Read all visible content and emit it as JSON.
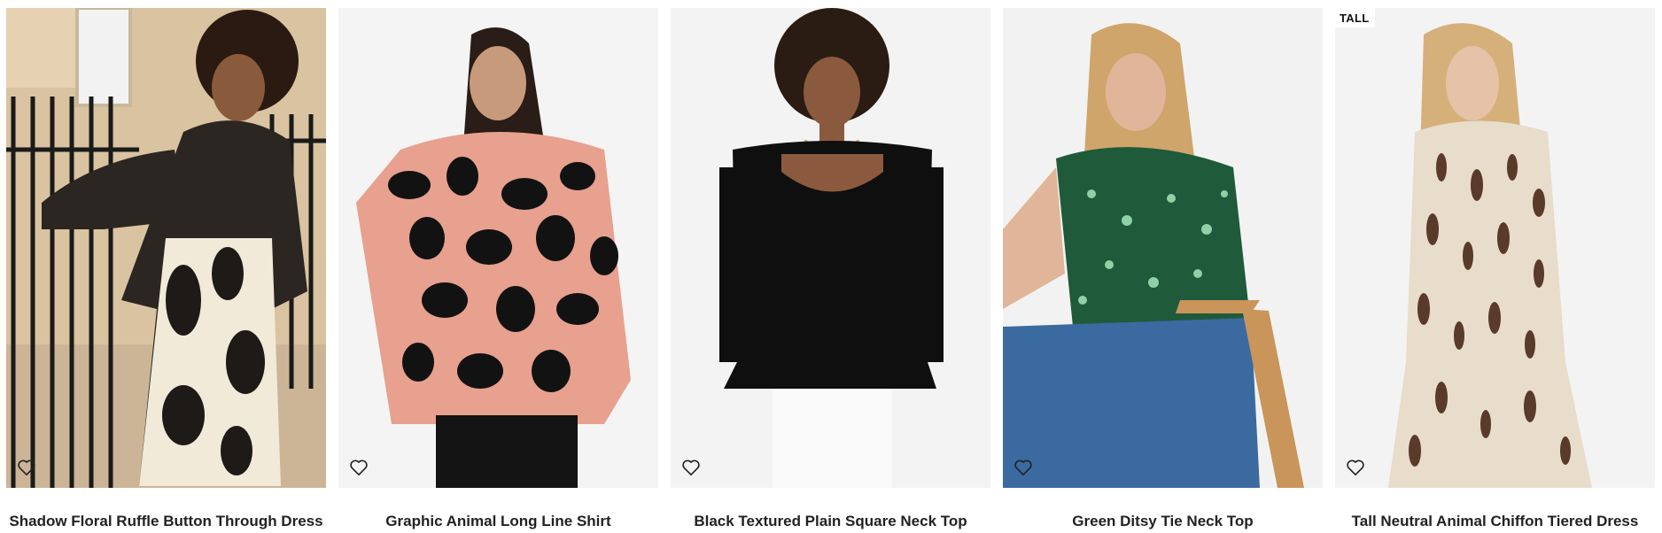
{
  "products": [
    {
      "title": "Shadow Floral Ruffle Button Through Dress",
      "badge": "",
      "wishlist_icon": "heart-outline-icon"
    },
    {
      "title": "Graphic Animal Long Line Shirt",
      "badge": "",
      "wishlist_icon": "heart-outline-icon"
    },
    {
      "title": "Black Textured Plain Square Neck Top",
      "badge": "",
      "wishlist_icon": "heart-outline-icon"
    },
    {
      "title": "Green Ditsy Tie Neck Top",
      "badge": "",
      "wishlist_icon": "heart-outline-icon"
    },
    {
      "title": "Tall Neutral Animal Chiffon Tiered Dress",
      "badge": "TALL",
      "wishlist_icon": "heart-outline-icon"
    }
  ],
  "colors": {
    "title_text": "#222222",
    "icon_stroke": "#222222",
    "badge_bg": "#ffffff"
  }
}
